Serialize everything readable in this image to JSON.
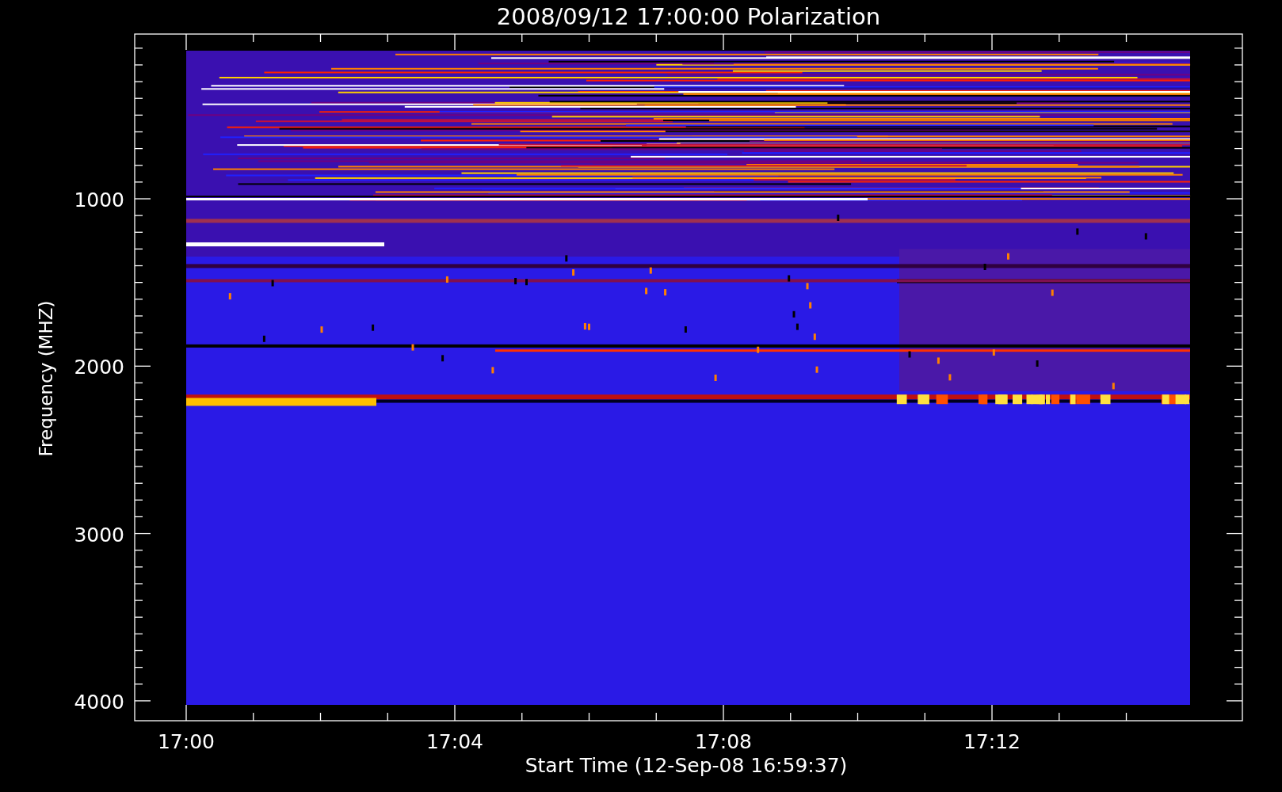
{
  "title": "2008/09/12 17:00:00 Polarization",
  "y_axis": {
    "label": "Frequency (MHZ)",
    "ticks": [
      "1000",
      "2000",
      "3000",
      "4000"
    ]
  },
  "x_axis": {
    "label": "Start Time (12-Sep-08 16:59:37)",
    "ticks": [
      "17:00",
      "17:04",
      "17:08",
      "17:12"
    ]
  }
}
